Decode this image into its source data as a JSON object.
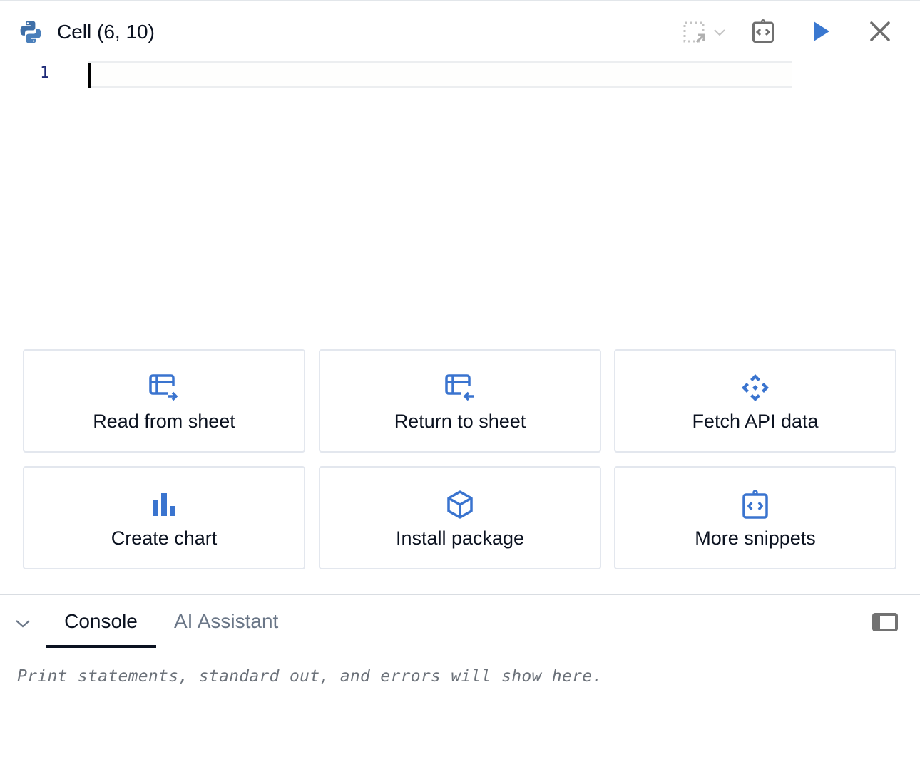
{
  "header": {
    "title": "Cell (6, 10)",
    "icons": {
      "language": "python-icon",
      "select_range": "select-range-icon",
      "select_dropdown": "chevron-down-icon",
      "snippets": "code-snippet-icon",
      "run": "play-icon",
      "close": "close-icon"
    },
    "run_color": "#3a78d0"
  },
  "editor": {
    "lines": [
      {
        "number": "1",
        "text": ""
      }
    ]
  },
  "snippets": [
    {
      "label": "Read from sheet",
      "icon": "table-arrow-right-icon"
    },
    {
      "label": "Return to sheet",
      "icon": "table-arrow-left-icon"
    },
    {
      "label": "Fetch API data",
      "icon": "api-icon"
    },
    {
      "label": "Create chart",
      "icon": "bar-chart-icon"
    },
    {
      "label": "Install package",
      "icon": "package-icon"
    },
    {
      "label": "More snippets",
      "icon": "code-snippet-icon"
    }
  ],
  "accent_color": "#3a74cf",
  "panel": {
    "tabs": [
      {
        "label": "Console",
        "active": true
      },
      {
        "label": "AI Assistant",
        "active": false
      }
    ],
    "console_placeholder": "Print statements, standard out, and errors will show here."
  }
}
